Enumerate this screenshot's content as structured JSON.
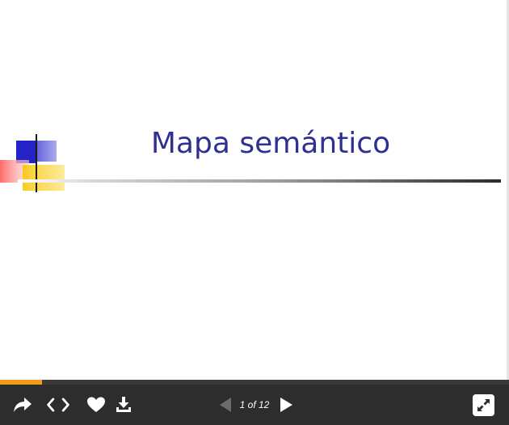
{
  "slide": {
    "title": "Mapa semántico"
  },
  "progress": {
    "fraction": 0.0833
  },
  "toolbar": {
    "page_indicator": "1 of 12",
    "icons": {
      "share": "share-icon",
      "embed": "embed-code-icon",
      "like": "heart-icon",
      "download": "download-icon",
      "previous": "previous-slide-icon",
      "next": "next-slide-icon",
      "fullscreen": "fullscreen-icon"
    }
  },
  "colors": {
    "title": "#2e3192",
    "toolbar_background": "#2d2d2d",
    "progress_fill": "#f29b1a",
    "progress_track": "#3a3a3a",
    "icon": "#ffffff",
    "icon_disabled": "#6b6b6b"
  }
}
